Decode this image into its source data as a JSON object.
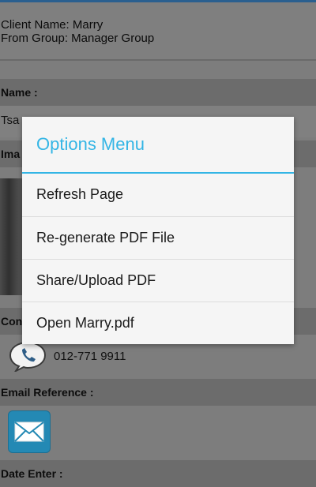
{
  "client": {
    "name_line": "Client Name: Marry",
    "group_line": "From Group: Manager Group"
  },
  "sections": {
    "name_header": "Name :",
    "name_value_partial": "Tsa",
    "image_header_partial": "Ima",
    "contact_header_partial": "Con",
    "phone_number": "012-771 9911",
    "email_header": "Email Reference :",
    "date_header": "Date Enter :"
  },
  "dialog": {
    "title": "Options Menu",
    "items": [
      {
        "label": "Refresh Page"
      },
      {
        "label": "Re-generate PDF File"
      },
      {
        "label": "Share/Upload PDF"
      },
      {
        "label": "Open Marry.pdf"
      }
    ]
  },
  "icons": {
    "phone": "phone-icon",
    "email": "mail-icon"
  },
  "colors": {
    "accent": "#33b5e5",
    "mail_icon_bg": "#2489b4"
  }
}
